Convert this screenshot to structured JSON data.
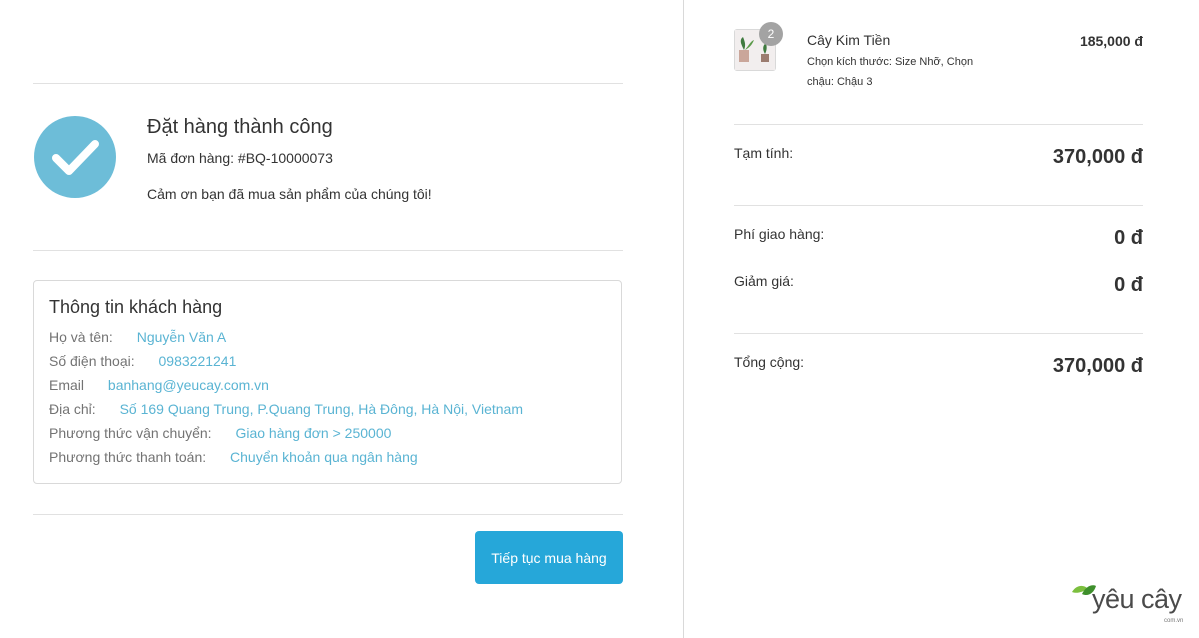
{
  "success": {
    "title": "Đặt hàng thành công",
    "order_code_label": "Mã đơn hàng: ",
    "order_code": "#BQ-10000073",
    "thanks": "Cảm ơn bạn đã mua sản phẩm của chúng tôi!"
  },
  "customer": {
    "title": "Thông tin khách hàng",
    "rows": [
      {
        "label": "Họ và tên:",
        "value": "Nguyễn Văn A"
      },
      {
        "label": "Số điện thoại:",
        "value": "0983221241"
      },
      {
        "label": "Email",
        "value": "banhang@yeucay.com.vn"
      },
      {
        "label": "Địa chỉ:",
        "value": "Số 169 Quang Trung, P.Quang Trung, Hà Đông, Hà Nội, Vietnam"
      },
      {
        "label": "Phương thức vận chuyển:",
        "value": "Giao hàng đơn > 250000"
      },
      {
        "label": "Phương thức thanh toán:",
        "value": "Chuyển khoản qua ngân hàng"
      }
    ]
  },
  "continue_button": "Tiếp tục mua hàng",
  "order_item": {
    "quantity": "2",
    "name": "Cây Kim Tiền",
    "variant": "Chọn kích thước: Size Nhỡ, Chọn chậu: Chậu 3",
    "price": "185,000 đ"
  },
  "summary": {
    "subtotal_label": "Tạm tính:",
    "subtotal": "370,000 đ",
    "shipping_label": "Phí giao hàng:",
    "shipping": "0 đ",
    "discount_label": "Giảm giá:",
    "discount": "0 đ",
    "total_label": "Tổng cộng:",
    "total": "370,000 đ"
  },
  "logo": {
    "text": "yêu cây",
    "sub": "com.vn"
  },
  "colors": {
    "accent_button": "#26a7d9",
    "check_circle": "#6dbdd8",
    "link_value": "#5ab4d3"
  }
}
